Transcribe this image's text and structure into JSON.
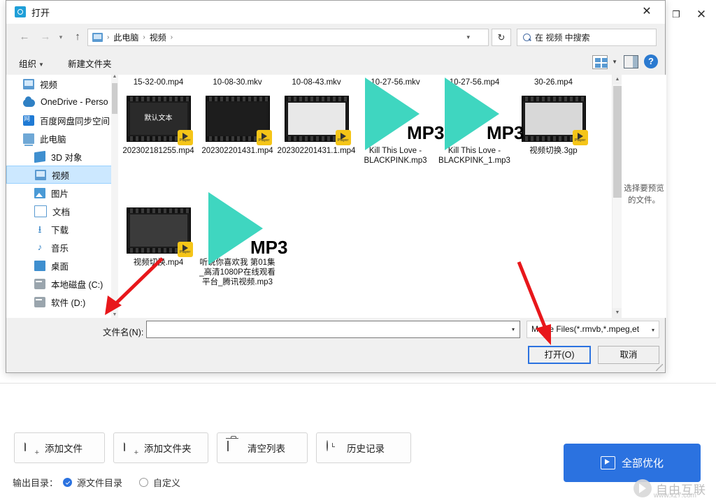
{
  "app": {
    "window_controls": {
      "maximize": "❐",
      "close": "✕"
    },
    "toolbar": [
      {
        "label": "添加文件",
        "icon": "file-plus-icon"
      },
      {
        "label": "添加文件夹",
        "icon": "folder-plus-icon"
      },
      {
        "label": "清空列表",
        "icon": "trash-icon"
      },
      {
        "label": "历史记录",
        "icon": "clock-icon"
      }
    ],
    "optimize_all": {
      "label": "全部优化",
      "icon": "play-box-icon",
      "color": "#2b72e0"
    },
    "output": {
      "label": "输出目录：",
      "option_source": "源文件目录",
      "option_custom": "自定义",
      "selected": "源文件目录"
    },
    "watermark": {
      "text": "自由互联",
      "url": "www.xz7.com"
    }
  },
  "dialog": {
    "title": "打开",
    "close": "✕",
    "nav": {
      "back": "←",
      "forward": "→",
      "recent": "▾",
      "up": "↑",
      "breadcrumb": [
        "此电脑",
        "视频"
      ],
      "breadcrumb_sep": "›",
      "dropdown_caret": "▾",
      "refresh": "↻"
    },
    "search": {
      "placeholder": "在 视频 中搜索",
      "icon": "search-icon"
    },
    "command_bar": {
      "organize": "组织",
      "new_folder": "新建文件夹",
      "view_icon": "view-layout-icon",
      "preview_pane_icon": "preview-pane-icon",
      "help": "?"
    },
    "nav_pane": [
      {
        "label": "视频",
        "icon": "folder-icon",
        "indent": false,
        "selected": false
      },
      {
        "label": "OneDrive - Perso",
        "icon": "cloud-icon",
        "indent": false,
        "selected": false
      },
      {
        "label": "百度网盘同步空间",
        "icon": "baidu-pan-icon",
        "indent": false,
        "selected": false
      },
      {
        "label": "此电脑",
        "icon": "pc-icon",
        "indent": false,
        "selected": false
      },
      {
        "label": "3D 对象",
        "icon": "3d-object-icon",
        "indent": true,
        "selected": false
      },
      {
        "label": "视频",
        "icon": "folder-icon",
        "indent": true,
        "selected": true
      },
      {
        "label": "图片",
        "icon": "pictures-icon",
        "indent": true,
        "selected": false
      },
      {
        "label": "文档",
        "icon": "documents-icon",
        "indent": true,
        "selected": false
      },
      {
        "label": "下载",
        "icon": "downloads-icon",
        "indent": true,
        "selected": false
      },
      {
        "label": "音乐",
        "icon": "music-icon",
        "indent": true,
        "selected": false
      },
      {
        "label": "桌面",
        "icon": "desktop-icon",
        "indent": true,
        "selected": false
      },
      {
        "label": "本地磁盘 (C:)",
        "icon": "disk-icon",
        "indent": true,
        "selected": false
      },
      {
        "label": "软件 (D:)",
        "icon": "disk-icon",
        "indent": true,
        "selected": false
      }
    ],
    "files": {
      "row0": [
        {
          "name": "15-32-00.mp4",
          "type": "video"
        },
        {
          "name": "10-08-30.mkv",
          "type": "video"
        },
        {
          "name": "10-08-43.mkv",
          "type": "video"
        },
        {
          "name": "10-27-56.mkv",
          "type": "video"
        },
        {
          "name": "10-27-56.mp4",
          "type": "video"
        },
        {
          "name": "30-26.mp4",
          "type": "video"
        }
      ],
      "row1": [
        {
          "name": "202302181255.mp4",
          "type": "video-thumb",
          "thumb_text": "默认文本"
        },
        {
          "name": "202302201431.mp4",
          "type": "video-thumb",
          "thumb_text": ""
        },
        {
          "name": "202302201431.1.mp4",
          "type": "video-thumb",
          "thumb_text": ""
        },
        {
          "name": "Kill This Love - BLACKPINK.mp3",
          "type": "mp3"
        },
        {
          "name": "Kill This Love - BLACKPINK_1.mp3",
          "type": "mp3"
        },
        {
          "name": "视频切换.3gp",
          "type": "video-thumb",
          "thumb_text": ""
        }
      ],
      "row2": [
        {
          "name": "视频切换.mp4",
          "type": "video-thumb",
          "thumb_text": ""
        },
        {
          "name": "听说你喜欢我 第01集_高清1080P在线观看平台_腾讯视频.mp3",
          "type": "mp3"
        }
      ],
      "mp3_label": "MP3"
    },
    "preview_pane": {
      "text": "选择要预览的文件。"
    },
    "filename": {
      "label": "文件名(N):",
      "value": "",
      "caret": "▾"
    },
    "filetype": {
      "value": "Movie Files(*.rmvb,*.mpeg,et",
      "caret": "▾"
    },
    "buttons": {
      "open": "打开(O)",
      "cancel": "取消"
    }
  }
}
